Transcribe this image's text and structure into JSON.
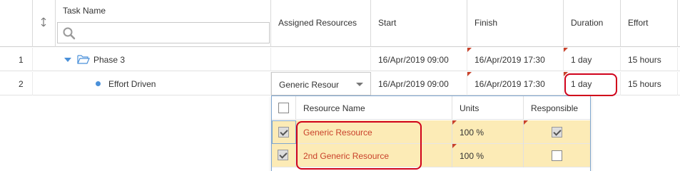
{
  "columns": {
    "task_name": "Task Name",
    "assigned_resources": "Assigned Resources",
    "start": "Start",
    "finish": "Finish",
    "duration": "Duration",
    "effort": "Effort"
  },
  "search": {
    "placeholder": ""
  },
  "rows": [
    {
      "num": "1",
      "name": "Phase 3",
      "resources": "",
      "start": "16/Apr/2019 09:00",
      "finish": "16/Apr/2019 17:30",
      "duration": "1 day",
      "effort": "15 hours"
    },
    {
      "num": "2",
      "name": "Effort Driven",
      "resources": "Generic Resour",
      "start": "16/Apr/2019 09:00",
      "finish": "16/Apr/2019 17:30",
      "duration": "1 day",
      "effort": "15 hours"
    }
  ],
  "popup": {
    "headers": {
      "name": "Resource Name",
      "units": "Units",
      "responsible": "Responsible"
    },
    "items": [
      {
        "name": "Generic Resource",
        "units": "100 %",
        "checked": true,
        "responsible": true
      },
      {
        "name": "2nd Generic Resource",
        "units": "100 %",
        "checked": true,
        "responsible": false
      }
    ]
  },
  "colors": {
    "accent_red": "#c9422b",
    "highlight": "#d0021b",
    "selected_row": "#fcebb6",
    "folder_blue": "#4a90d9"
  }
}
